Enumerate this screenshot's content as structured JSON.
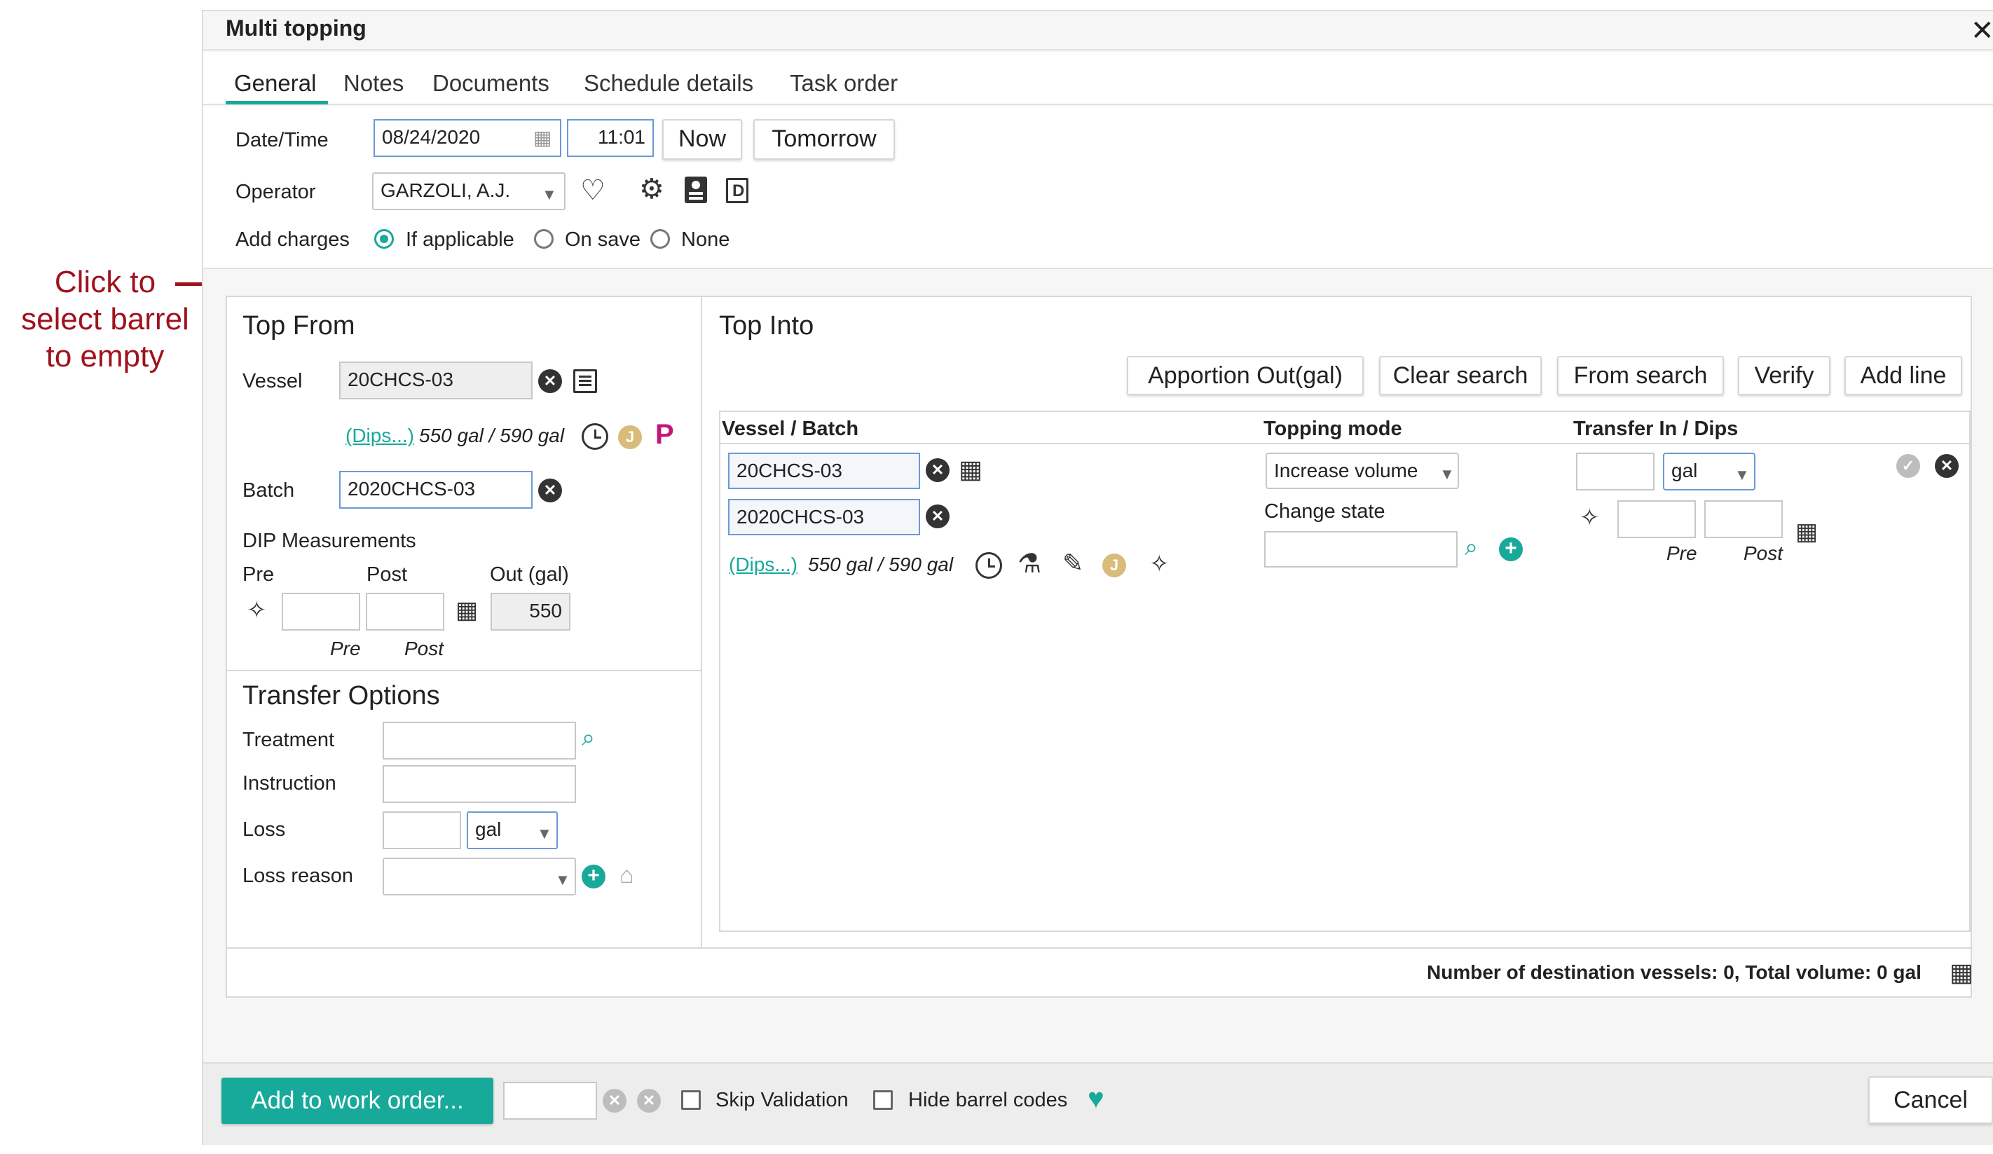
{
  "annotation": {
    "lines": [
      "Click to",
      "select barrel",
      "to empty"
    ]
  },
  "dialog": {
    "title": "Multi topping",
    "close_icon": "close-icon"
  },
  "tabs": [
    {
      "label": "General",
      "active": true
    },
    {
      "label": "Notes"
    },
    {
      "label": "Documents"
    },
    {
      "label": "Schedule details"
    },
    {
      "label": "Task order"
    }
  ],
  "general": {
    "datetime_label": "Date/Time",
    "date_value": "08/24/2020",
    "time_value": "11:01",
    "now_button": "Now",
    "tomorrow_button": "Tomorrow",
    "operator_label": "Operator",
    "operator_value": "GARZOLI, A.J.",
    "add_charges_label": "Add charges",
    "charges_options": [
      {
        "label": "If applicable",
        "checked": true
      },
      {
        "label": "On save",
        "checked": false
      },
      {
        "label": "None",
        "checked": false
      }
    ]
  },
  "top_from": {
    "heading": "Top From",
    "vessel_label": "Vessel",
    "vessel_value": "20CHCS-03",
    "dips_link": "(Dips...)",
    "volume_text": "550 gal / 590 gal",
    "j_badge": "J",
    "p_badge": "P",
    "batch_label": "Batch",
    "batch_value": "2020CHCS-03",
    "dip_heading": "DIP Measurements",
    "pre_label": "Pre",
    "post_label": "Post",
    "out_label": "Out (gal)",
    "out_value": "550",
    "pre_caption": "Pre",
    "post_caption": "Post"
  },
  "transfer_options": {
    "heading": "Transfer Options",
    "treatment_label": "Treatment",
    "instruction_label": "Instruction",
    "loss_label": "Loss",
    "loss_unit": "gal",
    "loss_reason_label": "Loss reason"
  },
  "top_into": {
    "heading": "Top Into",
    "buttons": [
      "Apportion Out(gal)",
      "Clear search",
      "From search",
      "Verify",
      "Add line"
    ],
    "col_vessel_batch": "Vessel / Batch",
    "col_topping_mode": "Topping mode",
    "col_transfer": "Transfer In / Dips",
    "row": {
      "vessel_value": "20CHCS-03",
      "batch_value": "2020CHCS-03",
      "dips_link": "(Dips...)",
      "volume_text": "550 gal / 590 gal",
      "j_badge": "J",
      "topping_mode": "Increase volume",
      "change_state_label": "Change state",
      "unit": "gal",
      "pre_caption": "Pre",
      "post_caption": "Post"
    },
    "summary": "Number of destination vessels: 0, Total volume: 0 gal"
  },
  "footer": {
    "add_button": "Add to work order...",
    "skip_validation": "Skip Validation",
    "hide_barrel_codes": "Hide barrel codes",
    "cancel_button": "Cancel"
  },
  "colors": {
    "accent": "#17a99a",
    "annotation": "#a0121e",
    "p_badge": "#c2177a"
  }
}
